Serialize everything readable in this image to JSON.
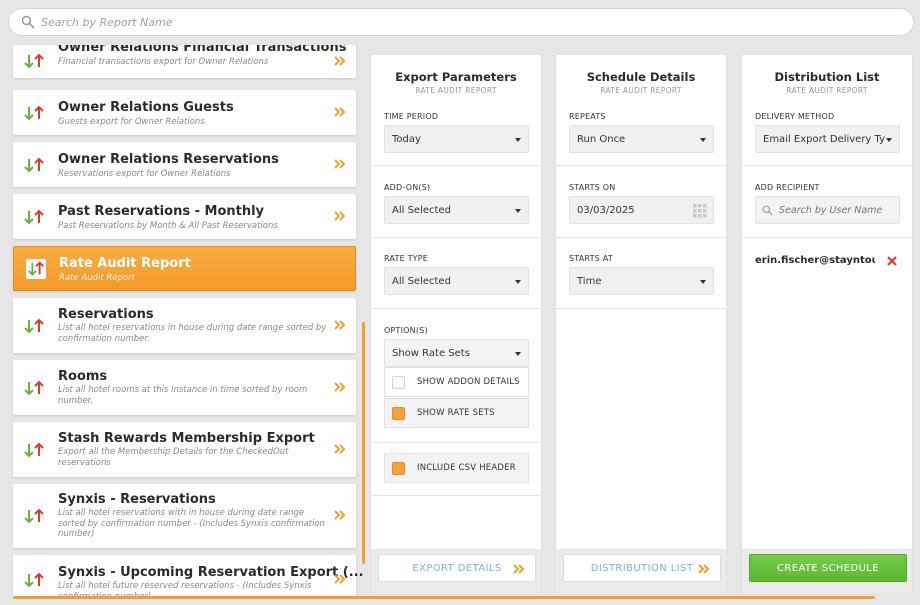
{
  "search": {
    "placeholder": "Search by Report Name"
  },
  "reports": [
    {
      "title": "Owner Relations Financial Transactions",
      "desc": "Financial transactions export for Owner Relations"
    },
    {
      "title": "Owner Relations Guests",
      "desc": "Guests export for Owner Relations"
    },
    {
      "title": "Owner Relations Reservations",
      "desc": "Reservations export for Owner Relations"
    },
    {
      "title": "Past Reservations - Monthly",
      "desc": "Past Reservations by Month & All Past Reservations"
    },
    {
      "title": "Rate Audit Report",
      "desc": "Rate Audit Report"
    },
    {
      "title": "Reservations",
      "desc": "List all hotel reservations in house during date range sorted by confirmation number."
    },
    {
      "title": "Rooms",
      "desc": "List all hotel rooms at this instance in time sorted by room number."
    },
    {
      "title": "Stash Rewards Membership Export",
      "desc": "Export all the Membership Details for the CheckedOut reservations"
    },
    {
      "title": "Synxis - Reservations",
      "desc": "List all hotel reservations with in house during date range sorted by confirmation number - (Includes Synxis confirmation number)"
    },
    {
      "title": "Synxis - Upcoming Reservation Export (...",
      "desc": "List all hotel future reserved reservations - (Includes Synxis confirmation number)"
    }
  ],
  "export": {
    "title": "Export Parameters",
    "subtitle": "RATE AUDIT REPORT",
    "time_period_label": "TIME PERIOD",
    "time_period_value": "Today",
    "addons_label": "ADD-ON(S)",
    "addons_value": "All Selected",
    "rate_type_label": "RATE TYPE",
    "rate_type_value": "All Selected",
    "options_label": "OPTION(S)",
    "options_value": "Show Rate Sets",
    "opt_addon_details": "SHOW ADDON DETAILS",
    "opt_rate_sets": "SHOW RATE SETS",
    "include_csv_header": "INCLUDE CSV HEADER",
    "footer_button": "EXPORT DETAILS"
  },
  "schedule": {
    "title": "Schedule Details",
    "subtitle": "RATE AUDIT REPORT",
    "repeats_label": "REPEATS",
    "repeats_value": "Run Once",
    "starts_on_label": "STARTS ON",
    "starts_on_value": "03/03/2025",
    "starts_at_label": "STARTS AT",
    "starts_at_value": "Time",
    "footer_button": "DISTRIBUTION LIST"
  },
  "distribution": {
    "title": "Distribution List",
    "subtitle": "RATE AUDIT REPORT",
    "delivery_label": "DELIVERY METHOD",
    "delivery_value": "Email Export Delivery Type",
    "recipient_label": "ADD RECIPIENT",
    "recipient_placeholder": "Search by User Name",
    "recipient_email": "erin.fischer@stayntou...",
    "footer_button": "CREATE SCHEDULE"
  },
  "colors": {
    "accent": "#f4a23c",
    "green": "#5bb832",
    "link": "#7eb2d6",
    "remove": "#e03a2f"
  }
}
